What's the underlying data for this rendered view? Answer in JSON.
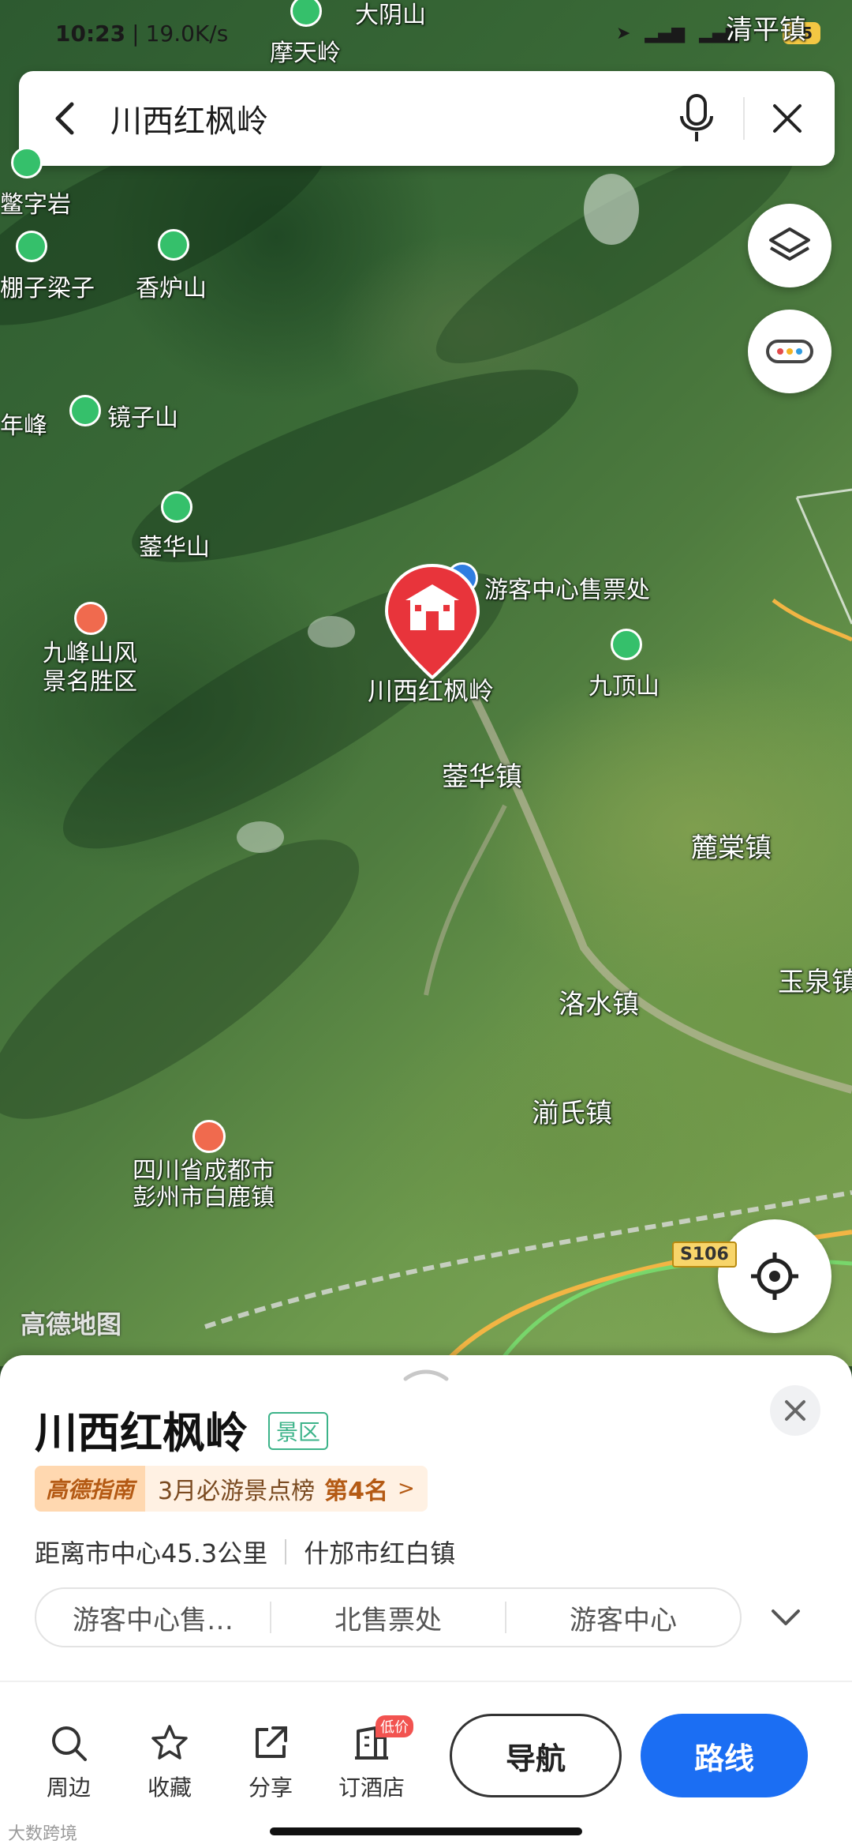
{
  "status_bar": {
    "time": "10:23",
    "net_speed": "19.0K/s",
    "battery": "65"
  },
  "search": {
    "query": "川西红枫岭"
  },
  "map": {
    "labels": {
      "dayinshan": "大阴山",
      "motianling": "摩天岭",
      "qingpingzhen": "清平镇",
      "yingziyan": "鳖字岩",
      "pengzi_liangzi": "棚子梁子",
      "xianglushan": "香炉山",
      "nianfeng": "年峰",
      "jingzishan": "镜子山",
      "yinghuashan": "蓥华山",
      "jiufengshan": "九峰山风\n景名胜区",
      "visitor_center": "游客中心售票处",
      "main_place": "川西红枫岭",
      "jiudingshan": "九顶山",
      "yinghuazhen": "蓥华镇",
      "lutangzhen": "麓棠镇",
      "yuquanzhen": "玉泉镇",
      "luoshuizhen": "洛水镇",
      "yushizhen": "湔氏镇",
      "bailuzhen": "四川省成都市\n彭州市白鹿镇"
    },
    "road_badge": "S106",
    "watermark": "高德地图"
  },
  "sheet": {
    "title": "川西红枫岭",
    "tag": "景区",
    "guide_brand": "高德指南",
    "guide_text": "3月必游景点榜",
    "guide_rank": "第4名",
    "guide_arrow": ">",
    "distance": "距离市中心45.3公里",
    "address": "什邡市红白镇",
    "chips": [
      "游客中心售…",
      "北售票处",
      "游客中心"
    ],
    "actions": {
      "nearby": "周边",
      "favorite": "收藏",
      "share": "分享",
      "hotel": "订酒店",
      "hotel_badge": "低价"
    },
    "navigate": "导航",
    "route": "路线"
  },
  "footer": {
    "corner_watermark": "大数跨境"
  },
  "colors": {
    "primary_blue": "#1b6ef3",
    "pin_red": "#e8343b",
    "peak_green": "#35c06b",
    "scenic_orange": "#f06a4e"
  }
}
